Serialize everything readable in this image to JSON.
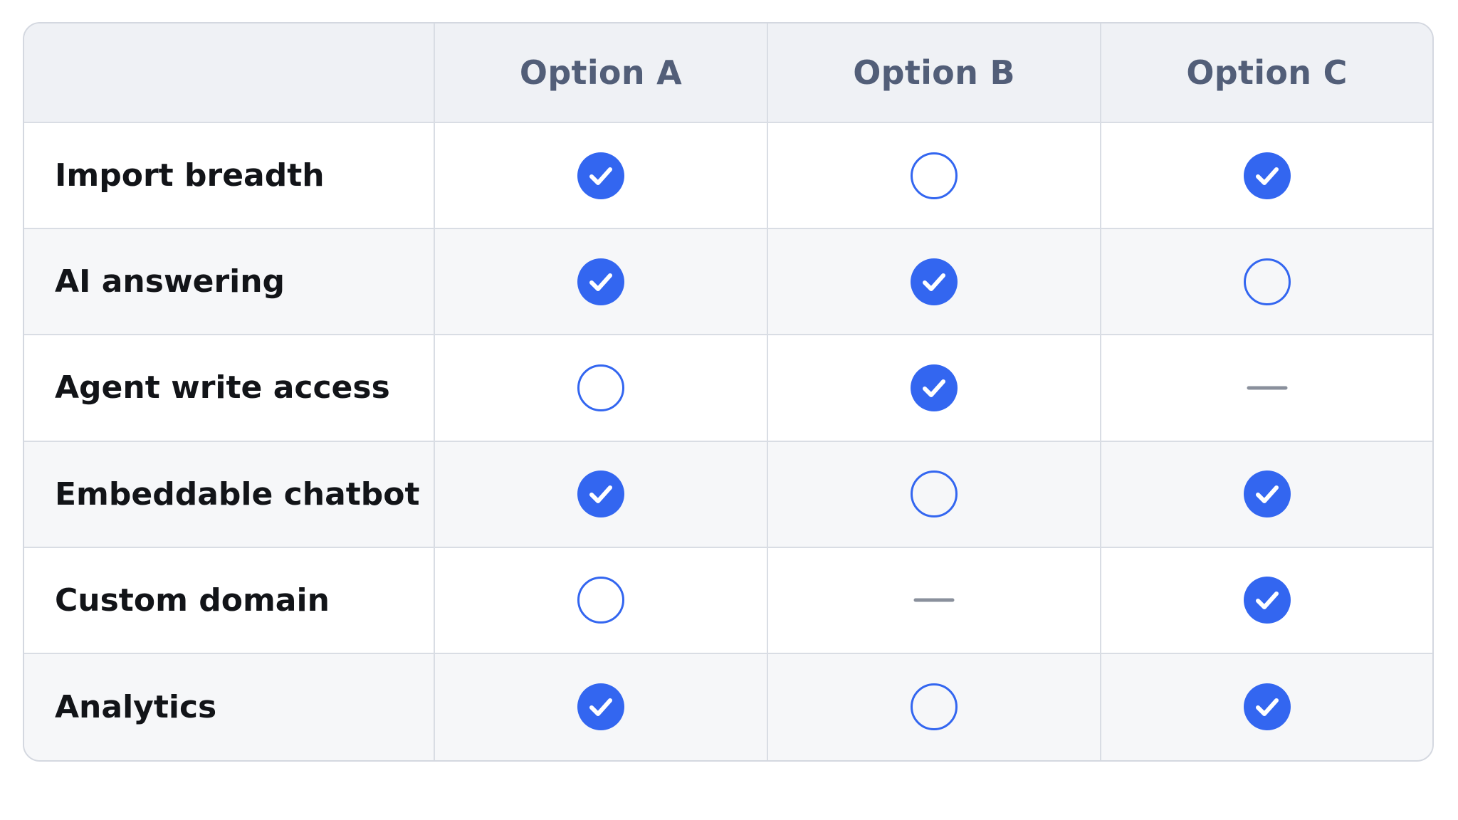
{
  "header": {
    "columns": [
      "",
      "Option A",
      "Option B",
      "Option C"
    ]
  },
  "colors": {
    "accent": "#3366f0",
    "check_mark": "#ffffff",
    "dash": "#8a909c",
    "header_bg": "#eff1f5",
    "header_text": "#525e78",
    "border": "#d4d8e0"
  },
  "rows": [
    {
      "feature": "Import breadth",
      "values": [
        "check",
        "empty",
        "check"
      ]
    },
    {
      "feature": "AI answering",
      "values": [
        "check",
        "check",
        "empty"
      ]
    },
    {
      "feature": "Agent write access",
      "values": [
        "empty",
        "check",
        "dash"
      ]
    },
    {
      "feature": "Embeddable chatbot",
      "values": [
        "check",
        "empty",
        "check"
      ]
    },
    {
      "feature": "Custom domain",
      "values": [
        "empty",
        "dash",
        "check"
      ]
    },
    {
      "feature": "Analytics",
      "values": [
        "check",
        "empty",
        "check"
      ]
    }
  ]
}
